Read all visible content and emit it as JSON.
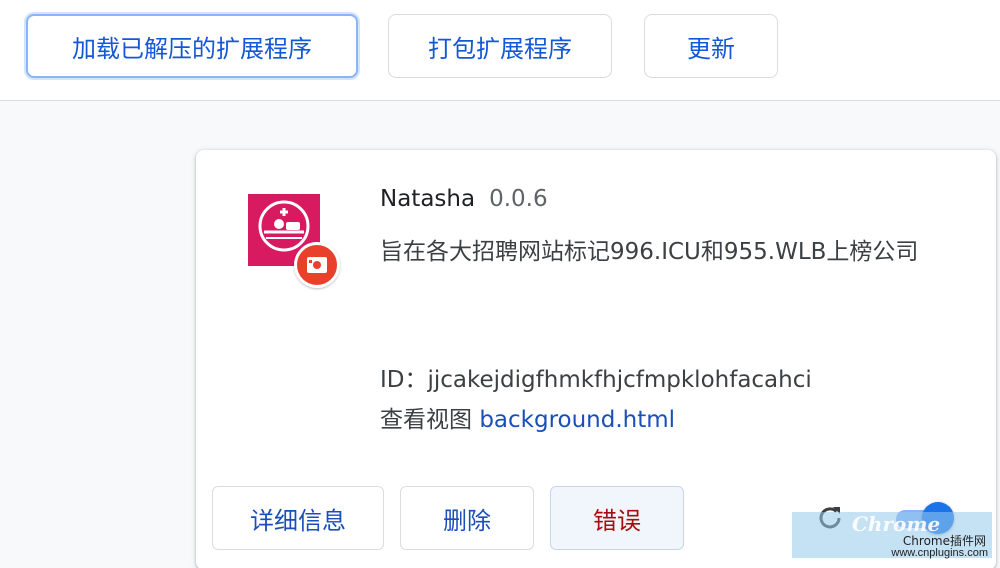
{
  "toolbar": {
    "load_unpacked": "加载已解压的扩展程序",
    "pack_extension": "打包扩展程序",
    "update": "更新"
  },
  "extension": {
    "name": "Natasha",
    "version": "0.0.6",
    "description": "旨在各大招聘网站标记996.ICU和955.WLB上榜公司",
    "id_label": "ID：",
    "id_value": "jjcakejdigfhmkfhjcfmpklohfacahci",
    "view_label": "查看视图",
    "view_link": "background.html",
    "icon": "natasha-extension-icon",
    "badge_icon": "unpacked-badge-icon",
    "enabled": true,
    "accent_color": "#d81b60"
  },
  "card_buttons": {
    "details": "详细信息",
    "remove": "删除",
    "errors": "错误"
  },
  "icons": {
    "reload": "reload-icon",
    "toggle": "enable-toggle"
  },
  "watermark": {
    "brand": "Chrome",
    "label": "Chrome插件网",
    "url": "www.cnplugins.com"
  }
}
